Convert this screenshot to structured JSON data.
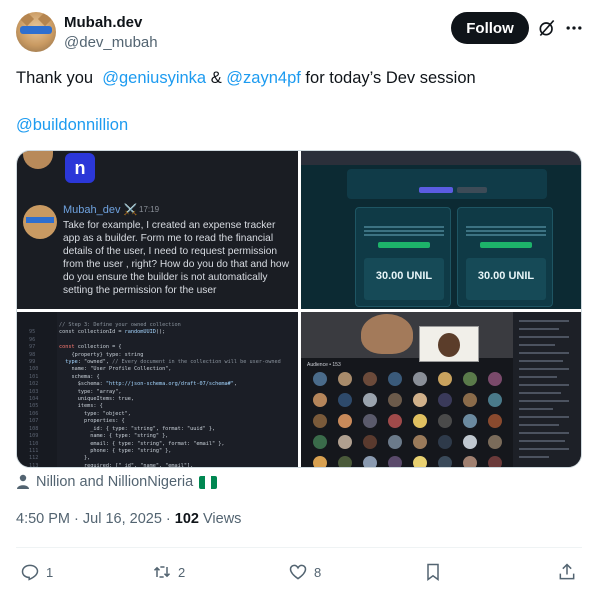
{
  "author": {
    "name": "Mubah.dev",
    "handle": "@dev_mubah"
  },
  "follow_label": "Follow",
  "tweet": {
    "prefix": "Thank you  ",
    "mention1": "@geniusyinka",
    "amp": " & ",
    "mention2": "@zayn4pf",
    "suffix": " for today’s Dev session",
    "mention3": "@buildonnillion"
  },
  "media": {
    "chat": {
      "name": "Mubah_dev ⚔️",
      "time": "17:19",
      "message": "Take for example, I created  an expense tracker app as a builder. Form me to read the financial details of the user, I need to request permission from the user , right?  How do you do that and how do you ensure the builder is not automatically setting the permission for the user"
    },
    "app": {
      "card1_amount": "30.00 UNIL",
      "card2_amount": "30.00 UNIL"
    },
    "call": {
      "audience_label": "Audience • 153"
    }
  },
  "community": "Nillion and NillionNigeria",
  "meta": {
    "time": "4:50 PM · Jul 16, 2025 · ",
    "views_count": "102",
    "views_label": " Views"
  },
  "actions": {
    "replies": "1",
    "reposts": "2",
    "likes": "8"
  },
  "colors": {
    "accent": "#1d9bf0",
    "text": "#0f1419",
    "muted": "#536471"
  }
}
